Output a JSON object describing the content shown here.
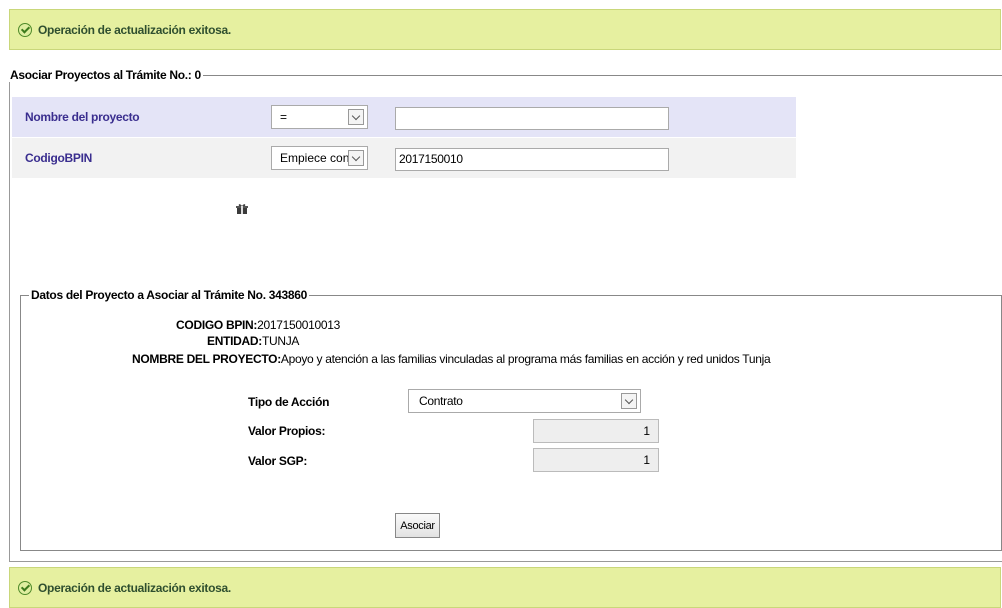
{
  "top_banner": {
    "message": "Operación de actualización exitosa."
  },
  "bottom_banner": {
    "message": "Operación de actualización exitosa."
  },
  "search_section": {
    "legend": "Asociar Proyectos al Trámite No.: 0",
    "rows": [
      {
        "label": "Nombre del proyecto",
        "operator": "=",
        "value": ""
      },
      {
        "label": "CodigoBPIN",
        "operator": "Empiece con",
        "value": "2017150010"
      }
    ]
  },
  "detail_section": {
    "legend": "Datos del Proyecto a Asociar al Trámite No. 343860",
    "codigo_bpin_label": "CODIGO BPIN:",
    "codigo_bpin_value": "2017150010013",
    "entidad_label": "ENTIDAD:",
    "entidad_value": "TUNJA",
    "nombre_label": "NOMBRE DEL PROYECTO:",
    "nombre_value": "Apoyo y atención a las familias vinculadas al programa más familias en acción y red unidos Tunja",
    "tipo_accion_label": "Tipo de Acción",
    "tipo_accion_value": "Contrato",
    "valor_propios_label": "Valor Propios:",
    "valor_propios_value": "1",
    "valor_sgp_label": "Valor SGP:",
    "valor_sgp_value": "1",
    "submit_label": "Asociar"
  },
  "icons": {
    "search_action": "gift-icon",
    "banner": "check-circle-icon",
    "dropdown": "chevron-down-icon"
  },
  "colors": {
    "banner_bg": "#e6f0a0",
    "label_purple": "#3a2e8f",
    "row1_bg": "#e4e4f7"
  }
}
